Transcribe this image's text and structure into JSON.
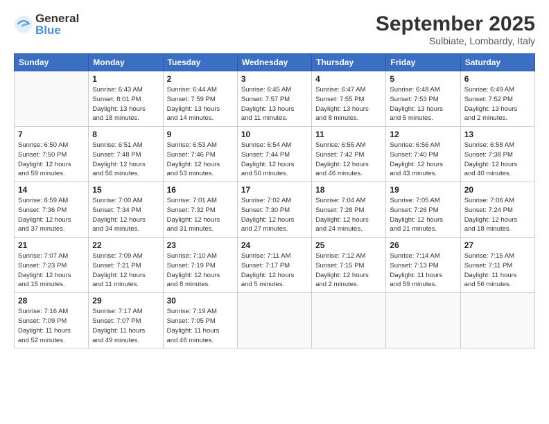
{
  "logo": {
    "general": "General",
    "blue": "Blue"
  },
  "title": "September 2025",
  "location": "Sulbiate, Lombardy, Italy",
  "headers": [
    "Sunday",
    "Monday",
    "Tuesday",
    "Wednesday",
    "Thursday",
    "Friday",
    "Saturday"
  ],
  "weeks": [
    [
      {
        "day": "",
        "lines": []
      },
      {
        "day": "1",
        "lines": [
          "Sunrise: 6:43 AM",
          "Sunset: 8:01 PM",
          "Daylight: 13 hours",
          "and 18 minutes."
        ]
      },
      {
        "day": "2",
        "lines": [
          "Sunrise: 6:44 AM",
          "Sunset: 7:59 PM",
          "Daylight: 13 hours",
          "and 14 minutes."
        ]
      },
      {
        "day": "3",
        "lines": [
          "Sunrise: 6:45 AM",
          "Sunset: 7:57 PM",
          "Daylight: 13 hours",
          "and 11 minutes."
        ]
      },
      {
        "day": "4",
        "lines": [
          "Sunrise: 6:47 AM",
          "Sunset: 7:55 PM",
          "Daylight: 13 hours",
          "and 8 minutes."
        ]
      },
      {
        "day": "5",
        "lines": [
          "Sunrise: 6:48 AM",
          "Sunset: 7:53 PM",
          "Daylight: 13 hours",
          "and 5 minutes."
        ]
      },
      {
        "day": "6",
        "lines": [
          "Sunrise: 6:49 AM",
          "Sunset: 7:52 PM",
          "Daylight: 13 hours",
          "and 2 minutes."
        ]
      }
    ],
    [
      {
        "day": "7",
        "lines": [
          "Sunrise: 6:50 AM",
          "Sunset: 7:50 PM",
          "Daylight: 12 hours",
          "and 59 minutes."
        ]
      },
      {
        "day": "8",
        "lines": [
          "Sunrise: 6:51 AM",
          "Sunset: 7:48 PM",
          "Daylight: 12 hours",
          "and 56 minutes."
        ]
      },
      {
        "day": "9",
        "lines": [
          "Sunrise: 6:53 AM",
          "Sunset: 7:46 PM",
          "Daylight: 12 hours",
          "and 53 minutes."
        ]
      },
      {
        "day": "10",
        "lines": [
          "Sunrise: 6:54 AM",
          "Sunset: 7:44 PM",
          "Daylight: 12 hours",
          "and 50 minutes."
        ]
      },
      {
        "day": "11",
        "lines": [
          "Sunrise: 6:55 AM",
          "Sunset: 7:42 PM",
          "Daylight: 12 hours",
          "and 46 minutes."
        ]
      },
      {
        "day": "12",
        "lines": [
          "Sunrise: 6:56 AM",
          "Sunset: 7:40 PM",
          "Daylight: 12 hours",
          "and 43 minutes."
        ]
      },
      {
        "day": "13",
        "lines": [
          "Sunrise: 6:58 AM",
          "Sunset: 7:38 PM",
          "Daylight: 12 hours",
          "and 40 minutes."
        ]
      }
    ],
    [
      {
        "day": "14",
        "lines": [
          "Sunrise: 6:59 AM",
          "Sunset: 7:36 PM",
          "Daylight: 12 hours",
          "and 37 minutes."
        ]
      },
      {
        "day": "15",
        "lines": [
          "Sunrise: 7:00 AM",
          "Sunset: 7:34 PM",
          "Daylight: 12 hours",
          "and 34 minutes."
        ]
      },
      {
        "day": "16",
        "lines": [
          "Sunrise: 7:01 AM",
          "Sunset: 7:32 PM",
          "Daylight: 12 hours",
          "and 31 minutes."
        ]
      },
      {
        "day": "17",
        "lines": [
          "Sunrise: 7:02 AM",
          "Sunset: 7:30 PM",
          "Daylight: 12 hours",
          "and 27 minutes."
        ]
      },
      {
        "day": "18",
        "lines": [
          "Sunrise: 7:04 AM",
          "Sunset: 7:28 PM",
          "Daylight: 12 hours",
          "and 24 minutes."
        ]
      },
      {
        "day": "19",
        "lines": [
          "Sunrise: 7:05 AM",
          "Sunset: 7:26 PM",
          "Daylight: 12 hours",
          "and 21 minutes."
        ]
      },
      {
        "day": "20",
        "lines": [
          "Sunrise: 7:06 AM",
          "Sunset: 7:24 PM",
          "Daylight: 12 hours",
          "and 18 minutes."
        ]
      }
    ],
    [
      {
        "day": "21",
        "lines": [
          "Sunrise: 7:07 AM",
          "Sunset: 7:23 PM",
          "Daylight: 12 hours",
          "and 15 minutes."
        ]
      },
      {
        "day": "22",
        "lines": [
          "Sunrise: 7:09 AM",
          "Sunset: 7:21 PM",
          "Daylight: 12 hours",
          "and 11 minutes."
        ]
      },
      {
        "day": "23",
        "lines": [
          "Sunrise: 7:10 AM",
          "Sunset: 7:19 PM",
          "Daylight: 12 hours",
          "and 8 minutes."
        ]
      },
      {
        "day": "24",
        "lines": [
          "Sunrise: 7:11 AM",
          "Sunset: 7:17 PM",
          "Daylight: 12 hours",
          "and 5 minutes."
        ]
      },
      {
        "day": "25",
        "lines": [
          "Sunrise: 7:12 AM",
          "Sunset: 7:15 PM",
          "Daylight: 12 hours",
          "and 2 minutes."
        ]
      },
      {
        "day": "26",
        "lines": [
          "Sunrise: 7:14 AM",
          "Sunset: 7:13 PM",
          "Daylight: 11 hours",
          "and 59 minutes."
        ]
      },
      {
        "day": "27",
        "lines": [
          "Sunrise: 7:15 AM",
          "Sunset: 7:11 PM",
          "Daylight: 11 hours",
          "and 56 minutes."
        ]
      }
    ],
    [
      {
        "day": "28",
        "lines": [
          "Sunrise: 7:16 AM",
          "Sunset: 7:09 PM",
          "Daylight: 11 hours",
          "and 52 minutes."
        ]
      },
      {
        "day": "29",
        "lines": [
          "Sunrise: 7:17 AM",
          "Sunset: 7:07 PM",
          "Daylight: 11 hours",
          "and 49 minutes."
        ]
      },
      {
        "day": "30",
        "lines": [
          "Sunrise: 7:19 AM",
          "Sunset: 7:05 PM",
          "Daylight: 11 hours",
          "and 46 minutes."
        ]
      },
      {
        "day": "",
        "lines": []
      },
      {
        "day": "",
        "lines": []
      },
      {
        "day": "",
        "lines": []
      },
      {
        "day": "",
        "lines": []
      }
    ]
  ]
}
